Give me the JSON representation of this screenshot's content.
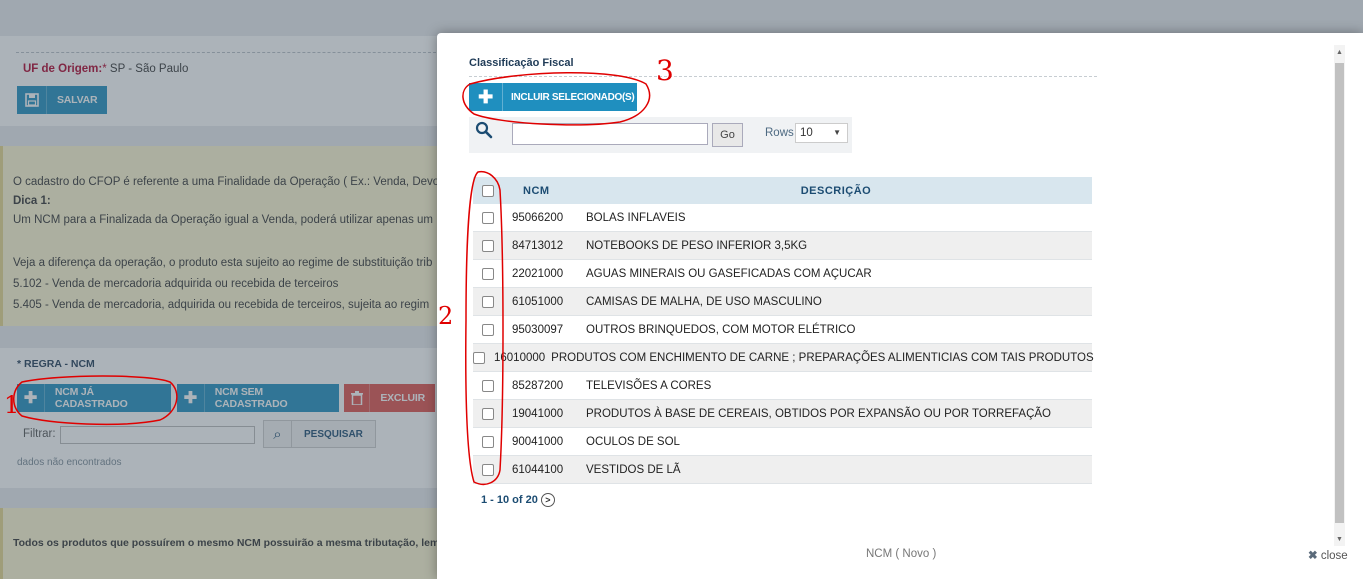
{
  "background": {
    "origin_label": "UF de Origem:",
    "required_mark": "*",
    "origin_value": "SP - São Paulo",
    "save_button": "SALVAR",
    "info_lines": [
      "O cadastro do CFOP é referente a uma Finalidade da Operação ( Ex.: Venda, Devo",
      "Dica 1:",
      "Um NCM para a Finalizada da Operação igual a Venda, poderá utilizar apenas um",
      "",
      "Veja a diferença da operação, o produto esta sujeito ao regime de substituição trib",
      "5.102 - Venda de mercadoria adquirida ou recebida de terceiros",
      "5.405 - Venda de mercadoria, adquirida ou recebida de terceiros, sujeita ao regim"
    ],
    "rule_title": "* REGRA - NCM",
    "btn_ncm_registered": "NCM JÁ CADASTRADO",
    "btn_ncm_unregistered": "NCM SEM CADASTRADO",
    "btn_delete": "EXCLUIR",
    "filter_label": "Filtrar:",
    "search_button": "PESQUISAR",
    "no_data": "dados não encontrados",
    "bottom_note": "Todos os produtos que possuírem o mesmo NCM possuirão a mesma tributação, lembr"
  },
  "modal": {
    "title": "Classificação Fiscal",
    "include_button": "INCLUIR SELECIONADO(S)",
    "go_button": "Go",
    "rows_label": "Rows",
    "rows_value": "10",
    "columns": [
      "NCM",
      "DESCRIÇÃO"
    ],
    "rows": [
      {
        "ncm": "95066200",
        "desc": "BOLAS INFLAVEIS"
      },
      {
        "ncm": "84713012",
        "desc": "NOTEBOOKS DE PESO INFERIOR 3,5KG"
      },
      {
        "ncm": "22021000",
        "desc": "AGUAS MINERAIS OU GASEFICADAS COM AÇUCAR"
      },
      {
        "ncm": "61051000",
        "desc": "CAMISAS DE MALHA, DE USO MASCULINO"
      },
      {
        "ncm": "95030097",
        "desc": "OUTROS BRINQUEDOS, COM MOTOR ELÉTRICO"
      },
      {
        "ncm": "16010000",
        "desc": "PRODUTOS COM ENCHIMENTO DE CARNE ; PREPARAÇÕES ALIMENTICIAS COM TAIS PRODUTOS"
      },
      {
        "ncm": "85287200",
        "desc": "TELEVISÕES A CORES"
      },
      {
        "ncm": "19041000",
        "desc": "PRODUTOS À BASE DE CEREAIS, OBTIDOS POR EXPANSÃO OU POR TORREFAÇÃO"
      },
      {
        "ncm": "90041000",
        "desc": "OCULOS DE SOL"
      },
      {
        "ncm": "61044100",
        "desc": "VESTIDOS DE LÃ"
      }
    ],
    "pager_text": "1 - 10 of 20",
    "footer_title": "NCM ( Novo )",
    "close_label": "close"
  },
  "annotations": [
    "1",
    "2",
    "3"
  ],
  "colors": {
    "primary_button": "#1f8fbf",
    "danger_button": "#e0504c",
    "table_header": "#d8e6ee",
    "annotation_red": "#e00000"
  },
  "icons": {
    "plus": "plus-icon",
    "save": "floppy-icon",
    "trash": "trash-icon",
    "search": "search-icon",
    "next": "chevron-right-icon",
    "close": "close-icon"
  }
}
